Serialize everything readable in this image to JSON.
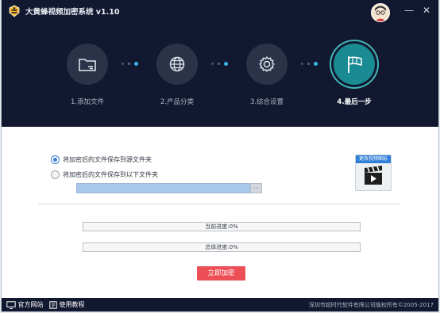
{
  "window": {
    "title": "大黄蜂视频加密系统 v1.10",
    "controls": {
      "minimize": "—",
      "close": "✕"
    }
  },
  "steps": [
    {
      "label": "1.添加文件",
      "icon": "folder-icon",
      "active": false
    },
    {
      "label": "2.产品分类",
      "icon": "globe-icon",
      "active": false
    },
    {
      "label": "3.综合设置",
      "icon": "gear-icon",
      "active": false
    },
    {
      "label": "4.最后一步",
      "icon": "flag-icon",
      "active": true
    }
  ],
  "output": {
    "option_source": "将加密后的文件保存到源文件夹",
    "option_custom": "将加密后的文件保存到以下文件夹",
    "selected": "source",
    "path_value": "",
    "browse_label": "..."
  },
  "change_icon": {
    "label": "更改视频图标"
  },
  "progress": {
    "current_label": "当前进度:0%",
    "current_value": 0,
    "total_label": "总体进度:0%",
    "total_value": 0
  },
  "actions": {
    "start_label": "立即加密"
  },
  "footer": {
    "website_label": "官方网站",
    "tutorial_label": "使用教程",
    "copyright": "深圳市超时代软件有限公司版权所有©2005-2017"
  },
  "colors": {
    "header_bg": "#12182f",
    "active_step": "#1a8a93",
    "accent_dot": "#35b8e6",
    "start_button": "#ec4f56",
    "radio_selected": "#3b7bd3"
  }
}
